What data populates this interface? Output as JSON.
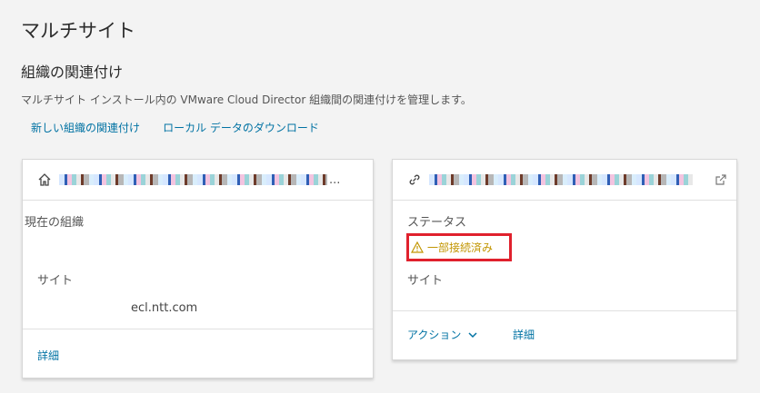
{
  "page": {
    "title": "マルチサイト",
    "section_title": "組織の関連付け",
    "description": "マルチサイト インストール内の VMware Cloud Director 組織間の関連付けを管理します。"
  },
  "actions": {
    "new_association": "新しい組織の関連付け",
    "download_local_data": "ローカル データのダウンロード"
  },
  "cards": {
    "local": {
      "header_icon": "home-icon",
      "ellipsis": "...",
      "current_org_label": "現在の組織",
      "site_label": "サイト",
      "site_value": "ecl.ntt.com",
      "details_link": "詳細"
    },
    "remote": {
      "header_icon": "link-icon",
      "external_icon": "external-link-icon",
      "status_label": "ステータス",
      "status_value": "一部接続済み",
      "status_color": "#c29500",
      "site_label": "サイト",
      "actions_link": "アクション",
      "details_link": "詳細"
    }
  },
  "colors": {
    "link": "#0072a3",
    "highlight_border": "#e0212d",
    "background": "#f3f3f3"
  }
}
